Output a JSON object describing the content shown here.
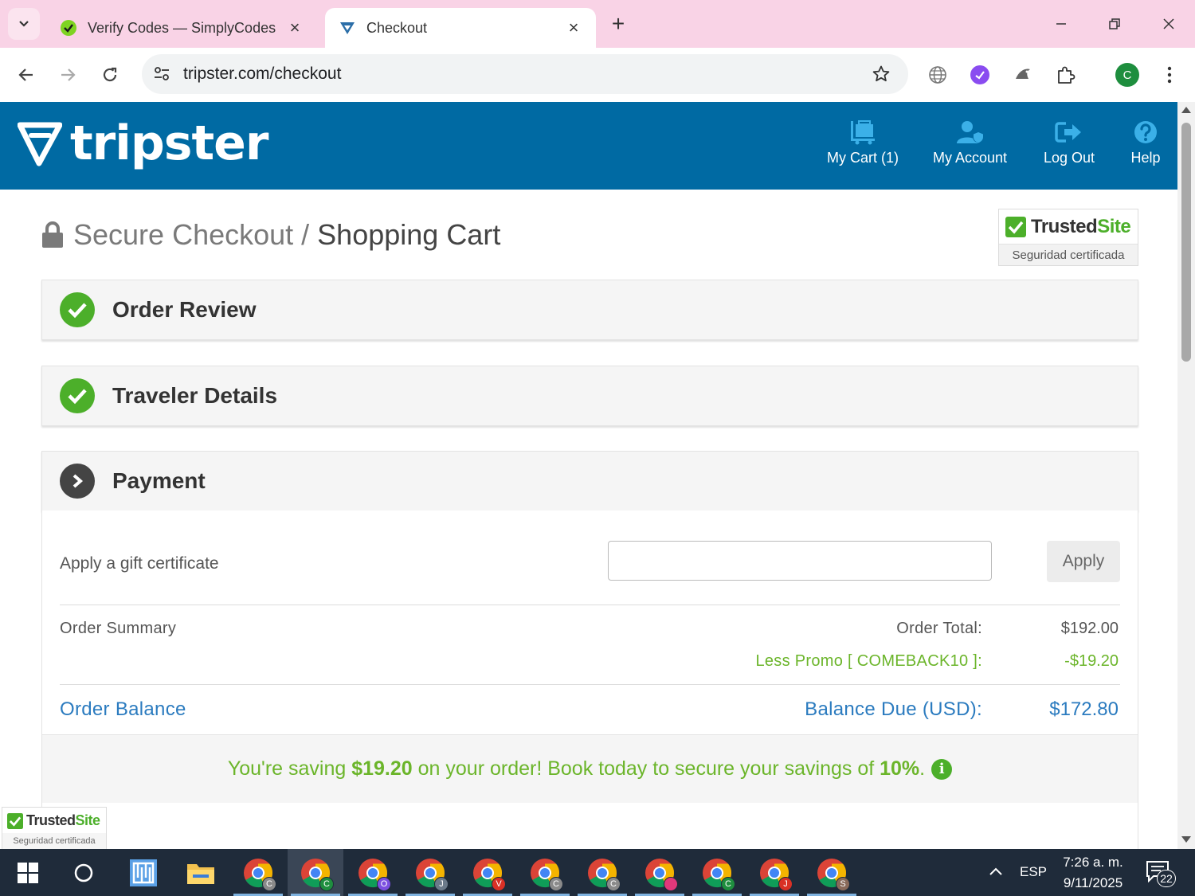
{
  "browser": {
    "tabs": [
      {
        "title": "Verify Codes — SimplyCodes",
        "active": false
      },
      {
        "title": "Checkout",
        "active": true
      }
    ],
    "url": "tripster.com/checkout",
    "profile_initial": "C"
  },
  "site": {
    "logo_text": "tripster",
    "nav": [
      {
        "label": "My Cart (1)",
        "icon": "cart-icon"
      },
      {
        "label": "My Account",
        "icon": "account-icon"
      },
      {
        "label": "Log Out",
        "icon": "logout-icon"
      },
      {
        "label": "Help",
        "icon": "help-icon"
      }
    ]
  },
  "page": {
    "title_part1": "Secure Checkout",
    "title_sep": "/",
    "title_part2": "Shopping Cart",
    "trusted_name_a": "Trusted",
    "trusted_name_b": "Site",
    "trusted_sub": "Seguridad certificada"
  },
  "sections": [
    {
      "title": "Order Review",
      "status": "complete"
    },
    {
      "title": "Traveler Details",
      "status": "complete"
    },
    {
      "title": "Payment",
      "status": "current"
    }
  ],
  "payment": {
    "gift_label": "Apply a gift certificate",
    "gift_value": "",
    "apply_label": "Apply",
    "summary_label": "Order Summary",
    "order_total_label": "Order Total:",
    "order_total_value": "$192.00",
    "promo_label": "Less Promo [ COMEBACK10 ]:",
    "promo_value": "-$19.20",
    "balance_label": "Order Balance",
    "balance_due_label": "Balance Due (USD):",
    "balance_due_value": "$172.80",
    "savings_pre": "You're saving ",
    "savings_amount": "$19.20",
    "savings_mid": " on your order! Book today to secure your savings of ",
    "savings_pct": "10%",
    "savings_end": ".",
    "info_glyph": "i"
  },
  "taskbar": {
    "chrome_badges": [
      "C",
      "C",
      "O",
      "J",
      "V",
      "C",
      "C",
      "",
      "C",
      "J",
      "S"
    ],
    "lang": "ESP",
    "time": "7:26 a. m.",
    "date": "9/11/2025",
    "notifications": "22"
  },
  "colors": {
    "header_bg": "#006aa3",
    "green": "#6bb52a",
    "link_blue": "#2b7bbf",
    "tab_bar": "#f9d3e6"
  }
}
